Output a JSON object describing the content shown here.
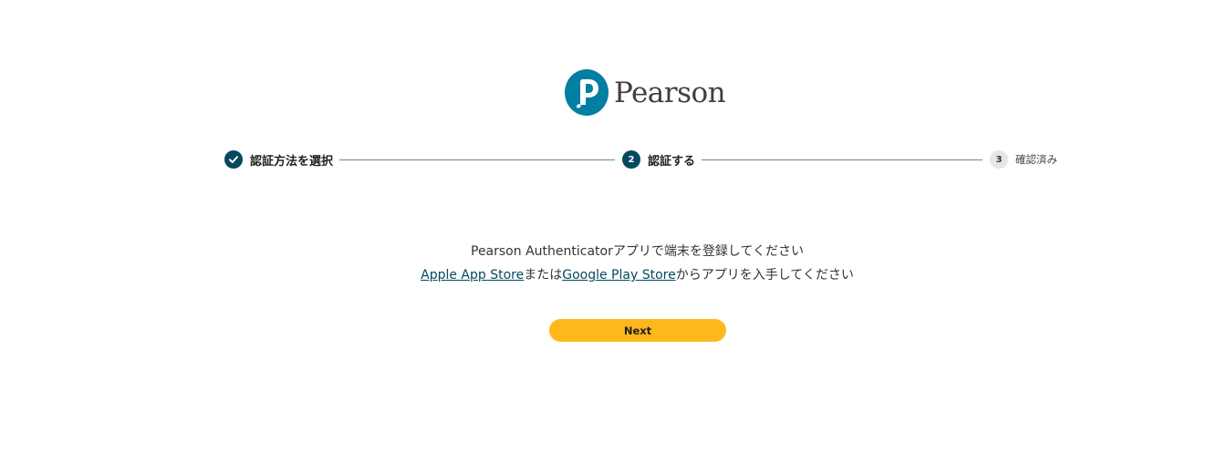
{
  "logo": {
    "brand_name": "Pearson",
    "brand_color": "#007fa3"
  },
  "stepper": {
    "steps": [
      {
        "number": "1",
        "label": "認証方法を選択",
        "state": "done"
      },
      {
        "number": "2",
        "label": "認証する",
        "state": "active"
      },
      {
        "number": "3",
        "label": "確認済み",
        "state": "todo"
      }
    ],
    "active_color": "#05485f"
  },
  "instructions": {
    "line1": "Pearson Authenticatorアプリで端末を登録してください",
    "apple_store_link": "Apple App Store",
    "connector": "または",
    "google_store_link": "Google Play Store",
    "line2_suffix": "からアプリを入手してください"
  },
  "actions": {
    "next_label": "Next",
    "button_color": "#ffb81c"
  }
}
